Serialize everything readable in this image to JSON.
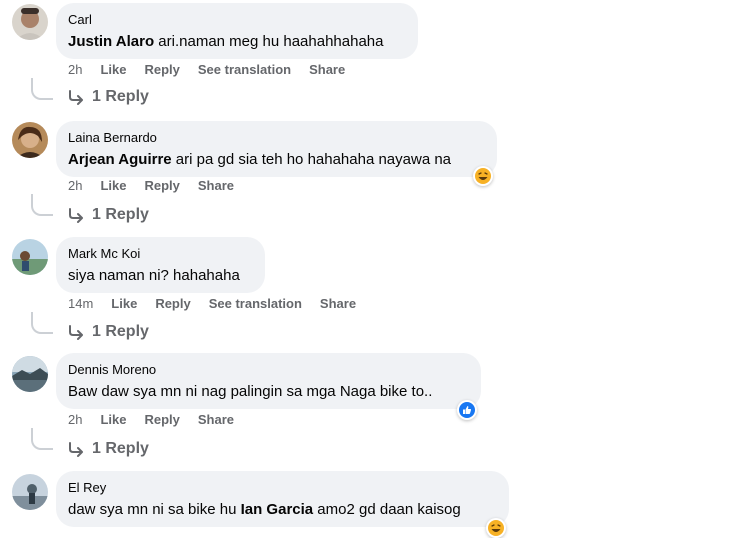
{
  "comments": [
    {
      "author": "Carl",
      "mention": "Justin Alaro",
      "text": " ari.naman meg hu haahahhahaha",
      "time": "2h",
      "actions": [
        "Like",
        "Reply",
        "See translation",
        "Share"
      ],
      "reply_count": "1 Reply"
    },
    {
      "author": "Laina Bernardo",
      "mention": "Arjean Aguirre",
      "text": " ari pa gd sia teh ho hahahaha nayawa na",
      "time": "2h",
      "actions": [
        "Like",
        "Reply",
        "Share"
      ],
      "reply_count": "1 Reply",
      "reaction": "haha-icon"
    },
    {
      "author": "Mark Mc Koi",
      "mention": "",
      "text": "siya naman ni? hahahaha",
      "time": "14m",
      "actions": [
        "Like",
        "Reply",
        "See translation",
        "Share"
      ],
      "reply_count": "1 Reply"
    },
    {
      "author": "Dennis Moreno",
      "mention": "",
      "text": "Baw daw sya mn ni nag palingin sa mga Naga bike to..",
      "time": "2h",
      "actions": [
        "Like",
        "Reply",
        "Share"
      ],
      "reply_count": "1 Reply",
      "reaction": "like-icon"
    },
    {
      "author": "El Rey",
      "text_before": "daw sya mn ni sa bike hu ",
      "mention": "Ian Garcia",
      "text": " amo2 gd daan kaisog",
      "reaction": "haha-icon"
    }
  ],
  "colors": {
    "bubble": "#f0f2f5",
    "meta": "#65676b",
    "like_blue": "#1877f2",
    "haha_yellow": "#f7b125"
  }
}
